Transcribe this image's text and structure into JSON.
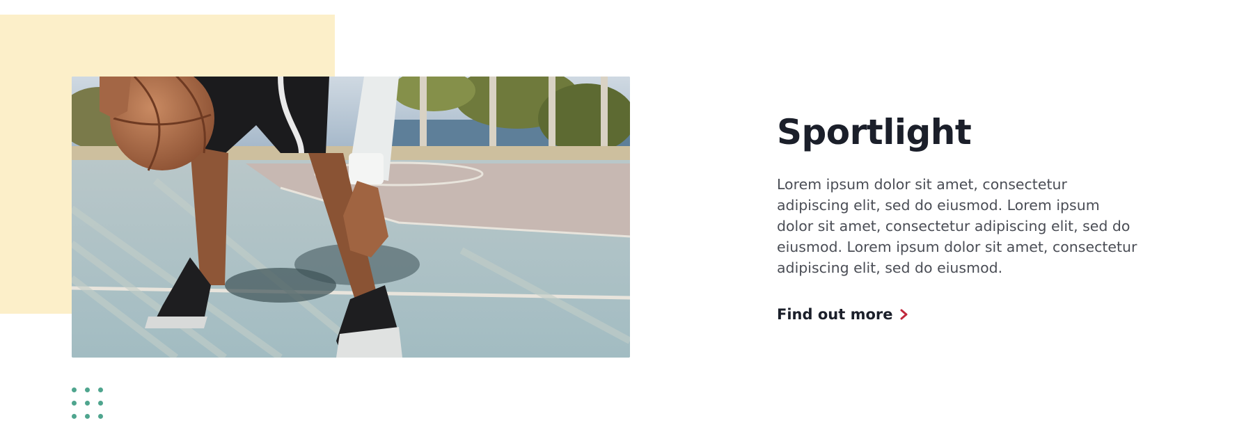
{
  "hero": {
    "image_alt": "Basketball player dribbling on an outdoor court",
    "accent_color": "#fcefc9"
  },
  "feature": {
    "title": "Sportlight",
    "description": "Lorem ipsum dolor sit amet, consectetur adipiscing elit, sed do eiusmod. Lorem ipsum dolor sit amet, consectetur adipiscing elit, sed do eiusmod. Lorem ipsum dolor sit amet, consectetur adipiscing elit, sed do eiusmod.",
    "cta_label": "Find out more",
    "cta_icon": "chevron-right-icon",
    "cta_icon_color": "#c0283c"
  },
  "decoration": {
    "dot_grid_color": "#4fa58e",
    "dot_grid_rows": 3,
    "dot_grid_cols": 3
  }
}
